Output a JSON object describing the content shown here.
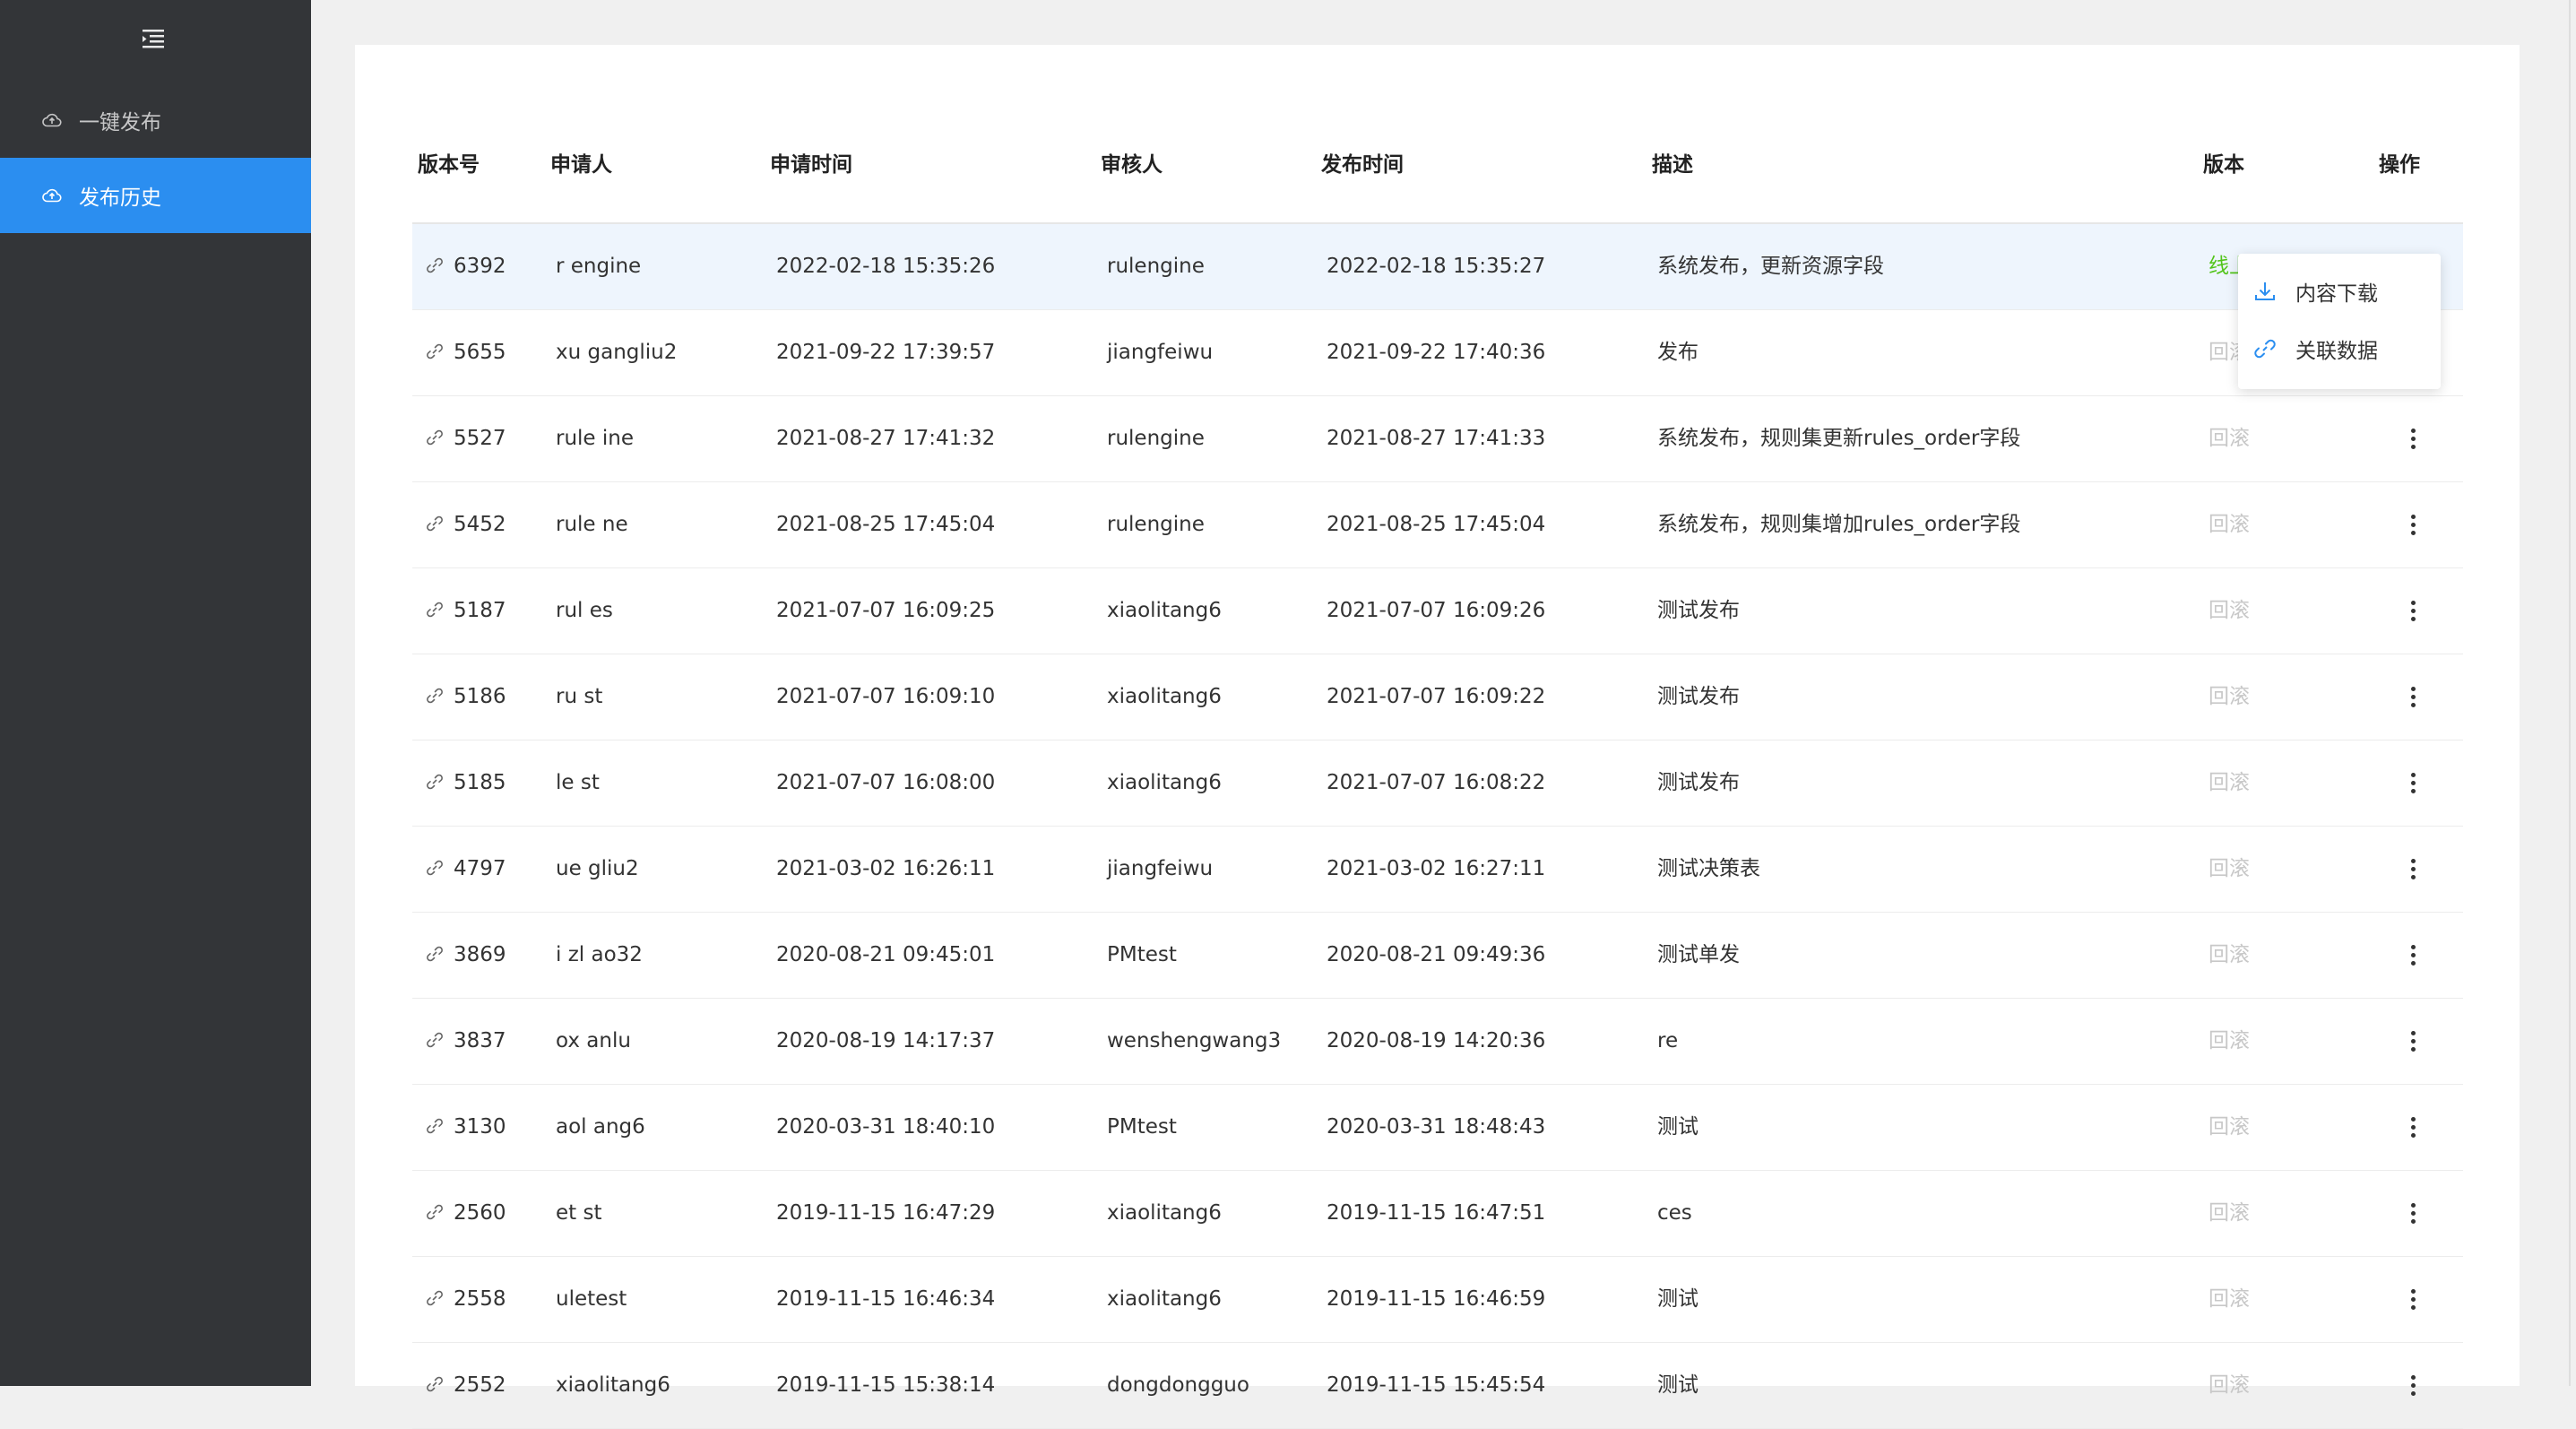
{
  "sidebar": {
    "collapse_icon": "menu-fold-icon",
    "items": [
      {
        "label": "一键发布",
        "icon": "cloud-upload-icon",
        "active": false
      },
      {
        "label": "发布历史",
        "icon": "cloud-upload-icon",
        "active": true
      }
    ]
  },
  "table": {
    "headers": [
      "版本号",
      "申请人",
      "申请时间",
      "审核人",
      "发布时间",
      "描述",
      "版本",
      "操作"
    ],
    "rows": [
      {
        "id": "6392",
        "applicant": "r  engine",
        "apply_time": "2022-02-18 15:35:26",
        "reviewer": "rulengine",
        "publish_time": "2022-02-18 15:35:27",
        "desc": "系统发布，更新资源字段",
        "version": "线上版本",
        "online": true
      },
      {
        "id": "5655",
        "applicant": "xu  gangliu2",
        "apply_time": "2021-09-22 17:39:57",
        "reviewer": "jiangfeiwu",
        "publish_time": "2021-09-22 17:40:36",
        "desc": "发布",
        "version": "回滚",
        "online": false
      },
      {
        "id": "5527",
        "applicant": "rule  ine",
        "apply_time": "2021-08-27 17:41:32",
        "reviewer": "rulengine",
        "publish_time": "2021-08-27 17:41:33",
        "desc": "系统发布，规则集更新rules_order字段",
        "version": "回滚",
        "online": false
      },
      {
        "id": "5452",
        "applicant": "rule  ne",
        "apply_time": "2021-08-25 17:45:04",
        "reviewer": "rulengine",
        "publish_time": "2021-08-25 17:45:04",
        "desc": "系统发布，规则集增加rules_order字段",
        "version": "回滚",
        "online": false
      },
      {
        "id": "5187",
        "applicant": "rul  es",
        "apply_time": "2021-07-07 16:09:25",
        "reviewer": "xiaolitang6",
        "publish_time": "2021-07-07 16:09:26",
        "desc": "测试发布",
        "version": "回滚",
        "online": false
      },
      {
        "id": "5186",
        "applicant": "ru  st",
        "apply_time": "2021-07-07 16:09:10",
        "reviewer": "xiaolitang6",
        "publish_time": "2021-07-07 16:09:22",
        "desc": "测试发布",
        "version": "回滚",
        "online": false
      },
      {
        "id": "5185",
        "applicant": "le  st",
        "apply_time": "2021-07-07 16:08:00",
        "reviewer": "xiaolitang6",
        "publish_time": "2021-07-07 16:08:22",
        "desc": "测试发布",
        "version": "回滚",
        "online": false
      },
      {
        "id": "4797",
        "applicant": "ue  gliu2",
        "apply_time": "2021-03-02 16:26:11",
        "reviewer": "jiangfeiwu",
        "publish_time": "2021-03-02 16:27:11",
        "desc": "测试决策表",
        "version": "回滚",
        "online": false
      },
      {
        "id": "3869",
        "applicant": "i  zl  ao32",
        "apply_time": "2020-08-21 09:45:01",
        "reviewer": "PMtest",
        "publish_time": "2020-08-21 09:49:36",
        "desc": "测试单发",
        "version": "回滚",
        "online": false
      },
      {
        "id": "3837",
        "applicant": "ox  anlu",
        "apply_time": "2020-08-19 14:17:37",
        "reviewer": "wenshengwang3",
        "publish_time": "2020-08-19 14:20:36",
        "desc": "re",
        "version": "回滚",
        "online": false
      },
      {
        "id": "3130",
        "applicant": "aol  ang6",
        "apply_time": "2020-03-31 18:40:10",
        "reviewer": "PMtest",
        "publish_time": "2020-03-31 18:48:43",
        "desc": "测试",
        "version": "回滚",
        "online": false
      },
      {
        "id": "2560",
        "applicant": "et  st",
        "apply_time": "2019-11-15 16:47:29",
        "reviewer": "xiaolitang6",
        "publish_time": "2019-11-15 16:47:51",
        "desc": "ces",
        "version": "回滚",
        "online": false
      },
      {
        "id": "2558",
        "applicant": "uletest",
        "apply_time": "2019-11-15 16:46:34",
        "reviewer": "xiaolitang6",
        "publish_time": "2019-11-15 16:46:59",
        "desc": "测试",
        "version": "回滚",
        "online": false
      },
      {
        "id": "2552",
        "applicant": "xiaolitang6",
        "apply_time": "2019-11-15 15:38:14",
        "reviewer": "dongdongguo",
        "publish_time": "2019-11-15 15:45:54",
        "desc": "测试",
        "version": "回滚",
        "online": false
      }
    ]
  },
  "dropdown": {
    "items": [
      {
        "label": "内容下载",
        "icon": "download-icon"
      },
      {
        "label": "关联数据",
        "icon": "link-icon"
      }
    ]
  },
  "colors": {
    "sidebar_bg": "#333538",
    "active_item": "#2b8ef0",
    "online_version": "#52c41a",
    "rollback_text": "#c8c8c8",
    "highlight_row": "#eef5fd",
    "icon_blue": "#2b8ef0"
  }
}
